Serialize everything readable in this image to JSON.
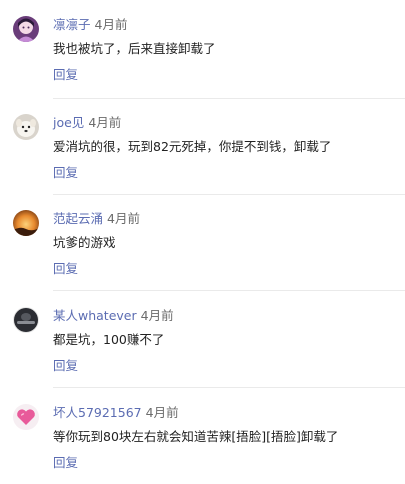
{
  "comments": [
    {
      "username": "凛凛子",
      "time": "4月前",
      "content": "我也被坑了，后来直接卸载了",
      "reply_label": "回复",
      "avatar_icon": "anime-girl-avatar-icon"
    },
    {
      "username": "joe见",
      "time": "4月前",
      "content": "爱消坑的很，玩到82元死掉，你提不到钱，卸载了",
      "reply_label": "回复",
      "avatar_icon": "white-dog-avatar-icon"
    },
    {
      "username": "范起云涌",
      "time": "4月前",
      "content": "坑爹的游戏",
      "reply_label": "回复",
      "avatar_icon": "orange-sunset-avatar-icon"
    },
    {
      "username": "某人whatever",
      "time": "4月前",
      "content": "都是坑，100赚不了",
      "reply_label": "回复",
      "avatar_icon": "dark-figure-avatar-icon"
    },
    {
      "username": "坏人57921567",
      "time": "4月前",
      "content": "等你玩到80块左右就会知道苦辣[捂脸][捂脸]卸载了",
      "reply_label": "回复",
      "avatar_icon": "pink-heart-avatar-icon"
    }
  ],
  "colors": {
    "username": "#5b6cb2",
    "reply": "#5b6cb2",
    "time": "#6b6b6b",
    "content": "#222222",
    "divider": "#eaeaea"
  }
}
